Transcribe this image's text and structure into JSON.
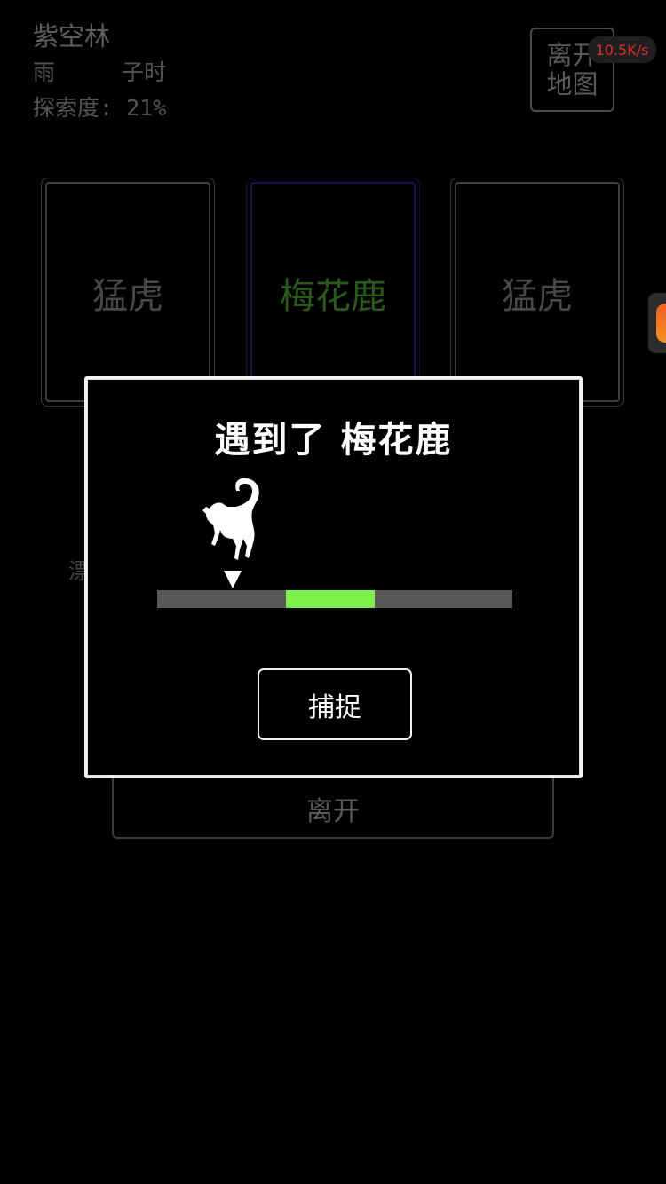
{
  "location": {
    "name": "紫空林",
    "weather": "雨",
    "time": "子时",
    "explore": "探索度: 21%"
  },
  "top_right": {
    "leave_map_line1": "离开",
    "leave_map_line2": "地图",
    "net_speed": "10.5K/s"
  },
  "cards": [
    {
      "name": "猛虎",
      "selected": false
    },
    {
      "name": "梅花鹿",
      "selected": true
    },
    {
      "name": "猛虎",
      "selected": false
    }
  ],
  "side_text": "漂",
  "leave_button": "离开",
  "dialog": {
    "title": "遇到了 梅花鹿",
    "catch_label": "捕捉",
    "bar": {
      "zone_start": 0.3625,
      "zone_end": 0.6125,
      "zone_color": "#7ef04a",
      "track_color": "#575757"
    },
    "marker_position": 0.21,
    "creature_icon": "cat-icon"
  },
  "colors": {
    "background": "#000000",
    "selected_card_text": "#2a5a1a",
    "net_speed": "#d92b2b"
  }
}
